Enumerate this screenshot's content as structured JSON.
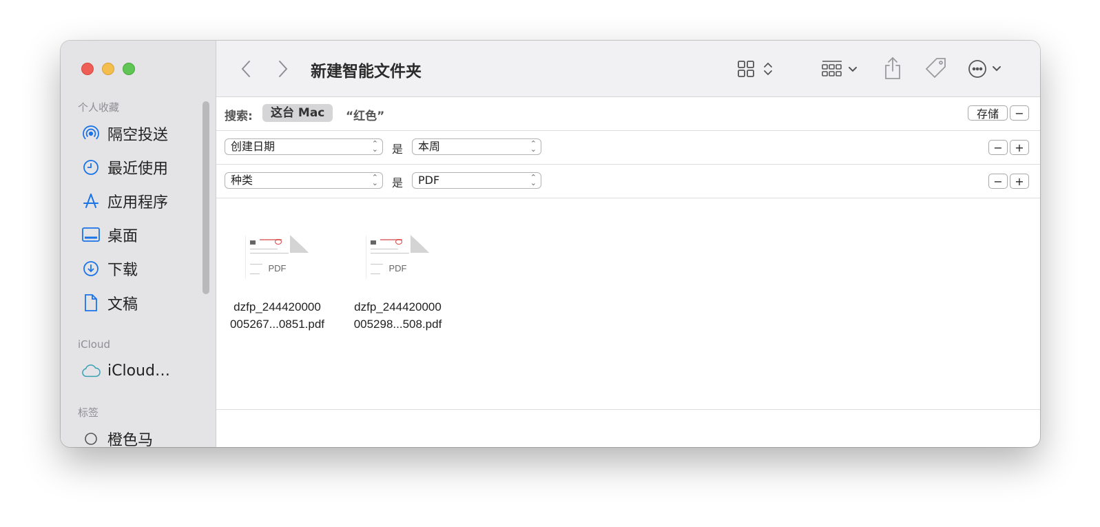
{
  "window": {
    "title": "新建智能文件夹"
  },
  "sidebar": {
    "favorites_label": "个人收藏",
    "favorites": [
      {
        "label": "隔空投送",
        "icon": "airdrop-icon"
      },
      {
        "label": "最近使用",
        "icon": "clock-icon"
      },
      {
        "label": "应用程序",
        "icon": "applications-icon"
      },
      {
        "label": "桌面",
        "icon": "desktop-icon"
      },
      {
        "label": "下载",
        "icon": "download-icon"
      },
      {
        "label": "文稿",
        "icon": "document-icon"
      }
    ],
    "icloud_label": "iCloud",
    "icloud_item": {
      "label": "iCloud…",
      "icon": "cloud-icon"
    },
    "tags_label": "标签",
    "tags_item": {
      "label": "橙色马",
      "icon": "tag-circle-icon"
    }
  },
  "toolbar": {
    "back_icon": "chevron-left-icon",
    "forward_icon": "chevron-right-icon",
    "view_icon": "icon-view-grid-icon",
    "group_icon": "group-grid-icon",
    "share_icon": "share-icon",
    "tag_icon": "tag-icon",
    "more_icon": "ellipsis-circle-icon",
    "search_icon": "search-icon"
  },
  "search_bar": {
    "label": "搜索:",
    "scope_active": "这台 Mac",
    "scope_other": "“红色”",
    "save_label": "存储",
    "remove_label": "−"
  },
  "criteria": [
    {
      "attribute": "创建日期",
      "operator": "是",
      "value": "本周",
      "remove": "−",
      "add": "+"
    },
    {
      "attribute": "种类",
      "operator": "是",
      "value": "PDF",
      "remove": "−",
      "add": "+"
    }
  ],
  "files": [
    {
      "line1": "dzfp_244420000",
      "line2": "005267...0851.pdf",
      "thumb_label": "PDF"
    },
    {
      "line1": "dzfp_244420000",
      "line2": "005298...508.pdf",
      "thumb_label": "PDF"
    }
  ],
  "colors": {
    "accent": "#1a73e8",
    "sidebar_bg": "#e4e4e6",
    "toolbar_bg": "#f1f1f3",
    "traffic_red": "#ee5e57",
    "traffic_yellow": "#f4be4f",
    "traffic_green": "#5fc554"
  }
}
